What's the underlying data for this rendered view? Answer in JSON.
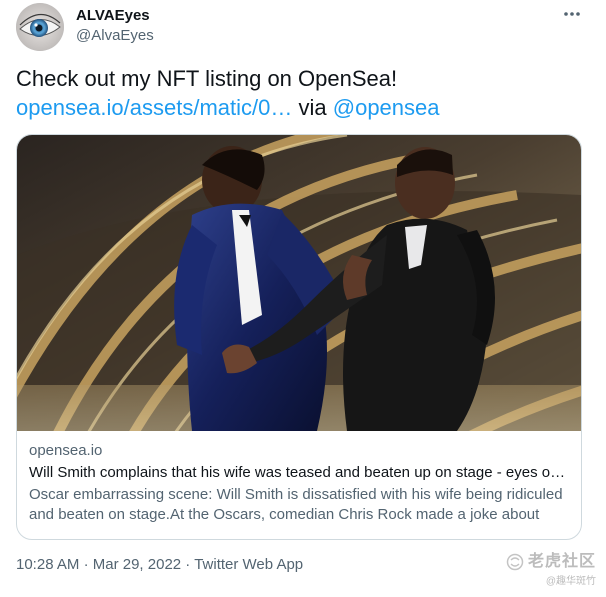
{
  "tweet": {
    "author": {
      "display_name": "ALVAEyes",
      "handle": "@AlvaEyes"
    },
    "text_line1": "Check out my NFT listing on OpenSea!",
    "link_text": "opensea.io/assets/matic/0…",
    "via_text": "via",
    "mention": "@opensea",
    "more_icon": "ellipsis-icon"
  },
  "card": {
    "domain": "opensea.io",
    "title": "Will Smith complains that his wife was teased and beaten up on stage - eyes of…",
    "description": "Oscar embarrassing scene: Will Smith is dissatisfied with his wife being ridiculed and beaten on stage.At the Oscars, comedian Chris Rock made a joke about W…"
  },
  "meta": {
    "time": "10:28 AM",
    "separator": "·",
    "date": "Mar 29, 2022",
    "source": "Twitter Web App"
  },
  "watermark": {
    "line1": "老虎社区",
    "line2": "@趣华斑竹"
  },
  "colors": {
    "link": "#1d9bf0",
    "secondary_text": "#536471",
    "primary_text": "#0f1419",
    "border": "#cfd9de"
  }
}
